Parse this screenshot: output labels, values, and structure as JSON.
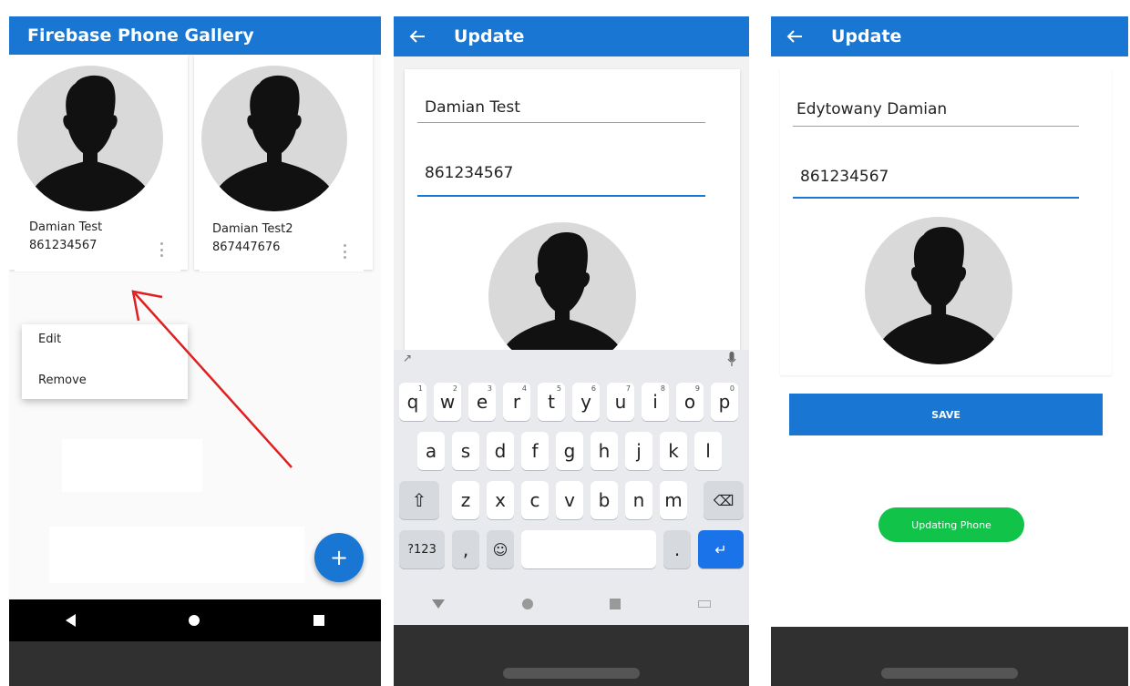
{
  "gallery": {
    "title": "Firebase Phone Gallery",
    "contacts": [
      {
        "name": "Damian Test",
        "phone": "861234567"
      },
      {
        "name": "Damian Test2",
        "phone": "867447676"
      }
    ],
    "menu": {
      "edit": "Edit",
      "remove": "Remove"
    },
    "fab_label": "+"
  },
  "update_keyboard": {
    "title": "Update",
    "name_value": "Damian Test",
    "phone_value": "861234567",
    "keys_row1": [
      "q",
      "w",
      "e",
      "r",
      "t",
      "y",
      "u",
      "i",
      "o",
      "p"
    ],
    "keys_row1_hints": [
      "1",
      "2",
      "3",
      "4",
      "5",
      "6",
      "7",
      "8",
      "9",
      "0"
    ],
    "keys_row2": [
      "a",
      "s",
      "d",
      "f",
      "g",
      "h",
      "j",
      "k",
      "l"
    ],
    "keys_row3": [
      "z",
      "x",
      "c",
      "v",
      "b",
      "n",
      "m"
    ],
    "key_symbols": "?123",
    "key_comma": ",",
    "key_period": "."
  },
  "update_saved": {
    "title": "Update",
    "name_value": "Edytowany Damian",
    "phone_value": "861234567",
    "save_label": "SAVE",
    "toast": "Updating Phone"
  },
  "colors": {
    "primary": "#1976d2",
    "toast": "#12c34a",
    "arrow": "#e02020"
  }
}
